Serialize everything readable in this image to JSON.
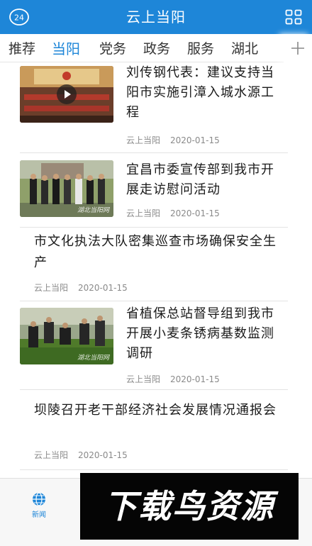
{
  "header": {
    "title": "云上当阳",
    "left_badge": "24",
    "left_icon": "circle-24-icon",
    "right_icon": "grid-menu-icon",
    "color": "#1e86d8"
  },
  "tabs": [
    {
      "label": "推荐",
      "active": false
    },
    {
      "label": "当阳",
      "active": true
    },
    {
      "label": "党务",
      "active": false
    },
    {
      "label": "政务",
      "active": false
    },
    {
      "label": "服务",
      "active": false
    },
    {
      "label": "湖北",
      "active": false
    }
  ],
  "tabs_more_icon": "plus-icon",
  "feed": [
    {
      "title": "刘传钢代表：建议支持当阳市实施引漳入城水源工程",
      "source": "云上当阳",
      "date": "2020-01-15",
      "has_image": true,
      "video": true
    },
    {
      "title": "宜昌市委宣传部到我市开展走访慰问活动",
      "source": "云上当阳",
      "date": "2020-01-15",
      "has_image": true,
      "video": false,
      "image_watermark": "湖北当阳网"
    },
    {
      "title": "市文化执法大队密集巡查市场确保安全生产",
      "source": "云上当阳",
      "date": "2020-01-15",
      "has_image": false
    },
    {
      "title": "省植保总站督导组到我市开展小麦条锈病基数监测调研",
      "source": "云上当阳",
      "date": "2020-01-15",
      "has_image": true,
      "video": false,
      "image_watermark": "湖北当阳网"
    },
    {
      "title": "坝陵召开老干部经济社会发展情况通报会",
      "source": "云上当阳",
      "date": "2020-01-15",
      "has_image": false
    }
  ],
  "bottom_nav": {
    "items": [
      {
        "label": "新闻",
        "icon": "globe-icon",
        "active": true
      }
    ]
  },
  "overlay_banner": {
    "text": "下载鸟资源"
  }
}
